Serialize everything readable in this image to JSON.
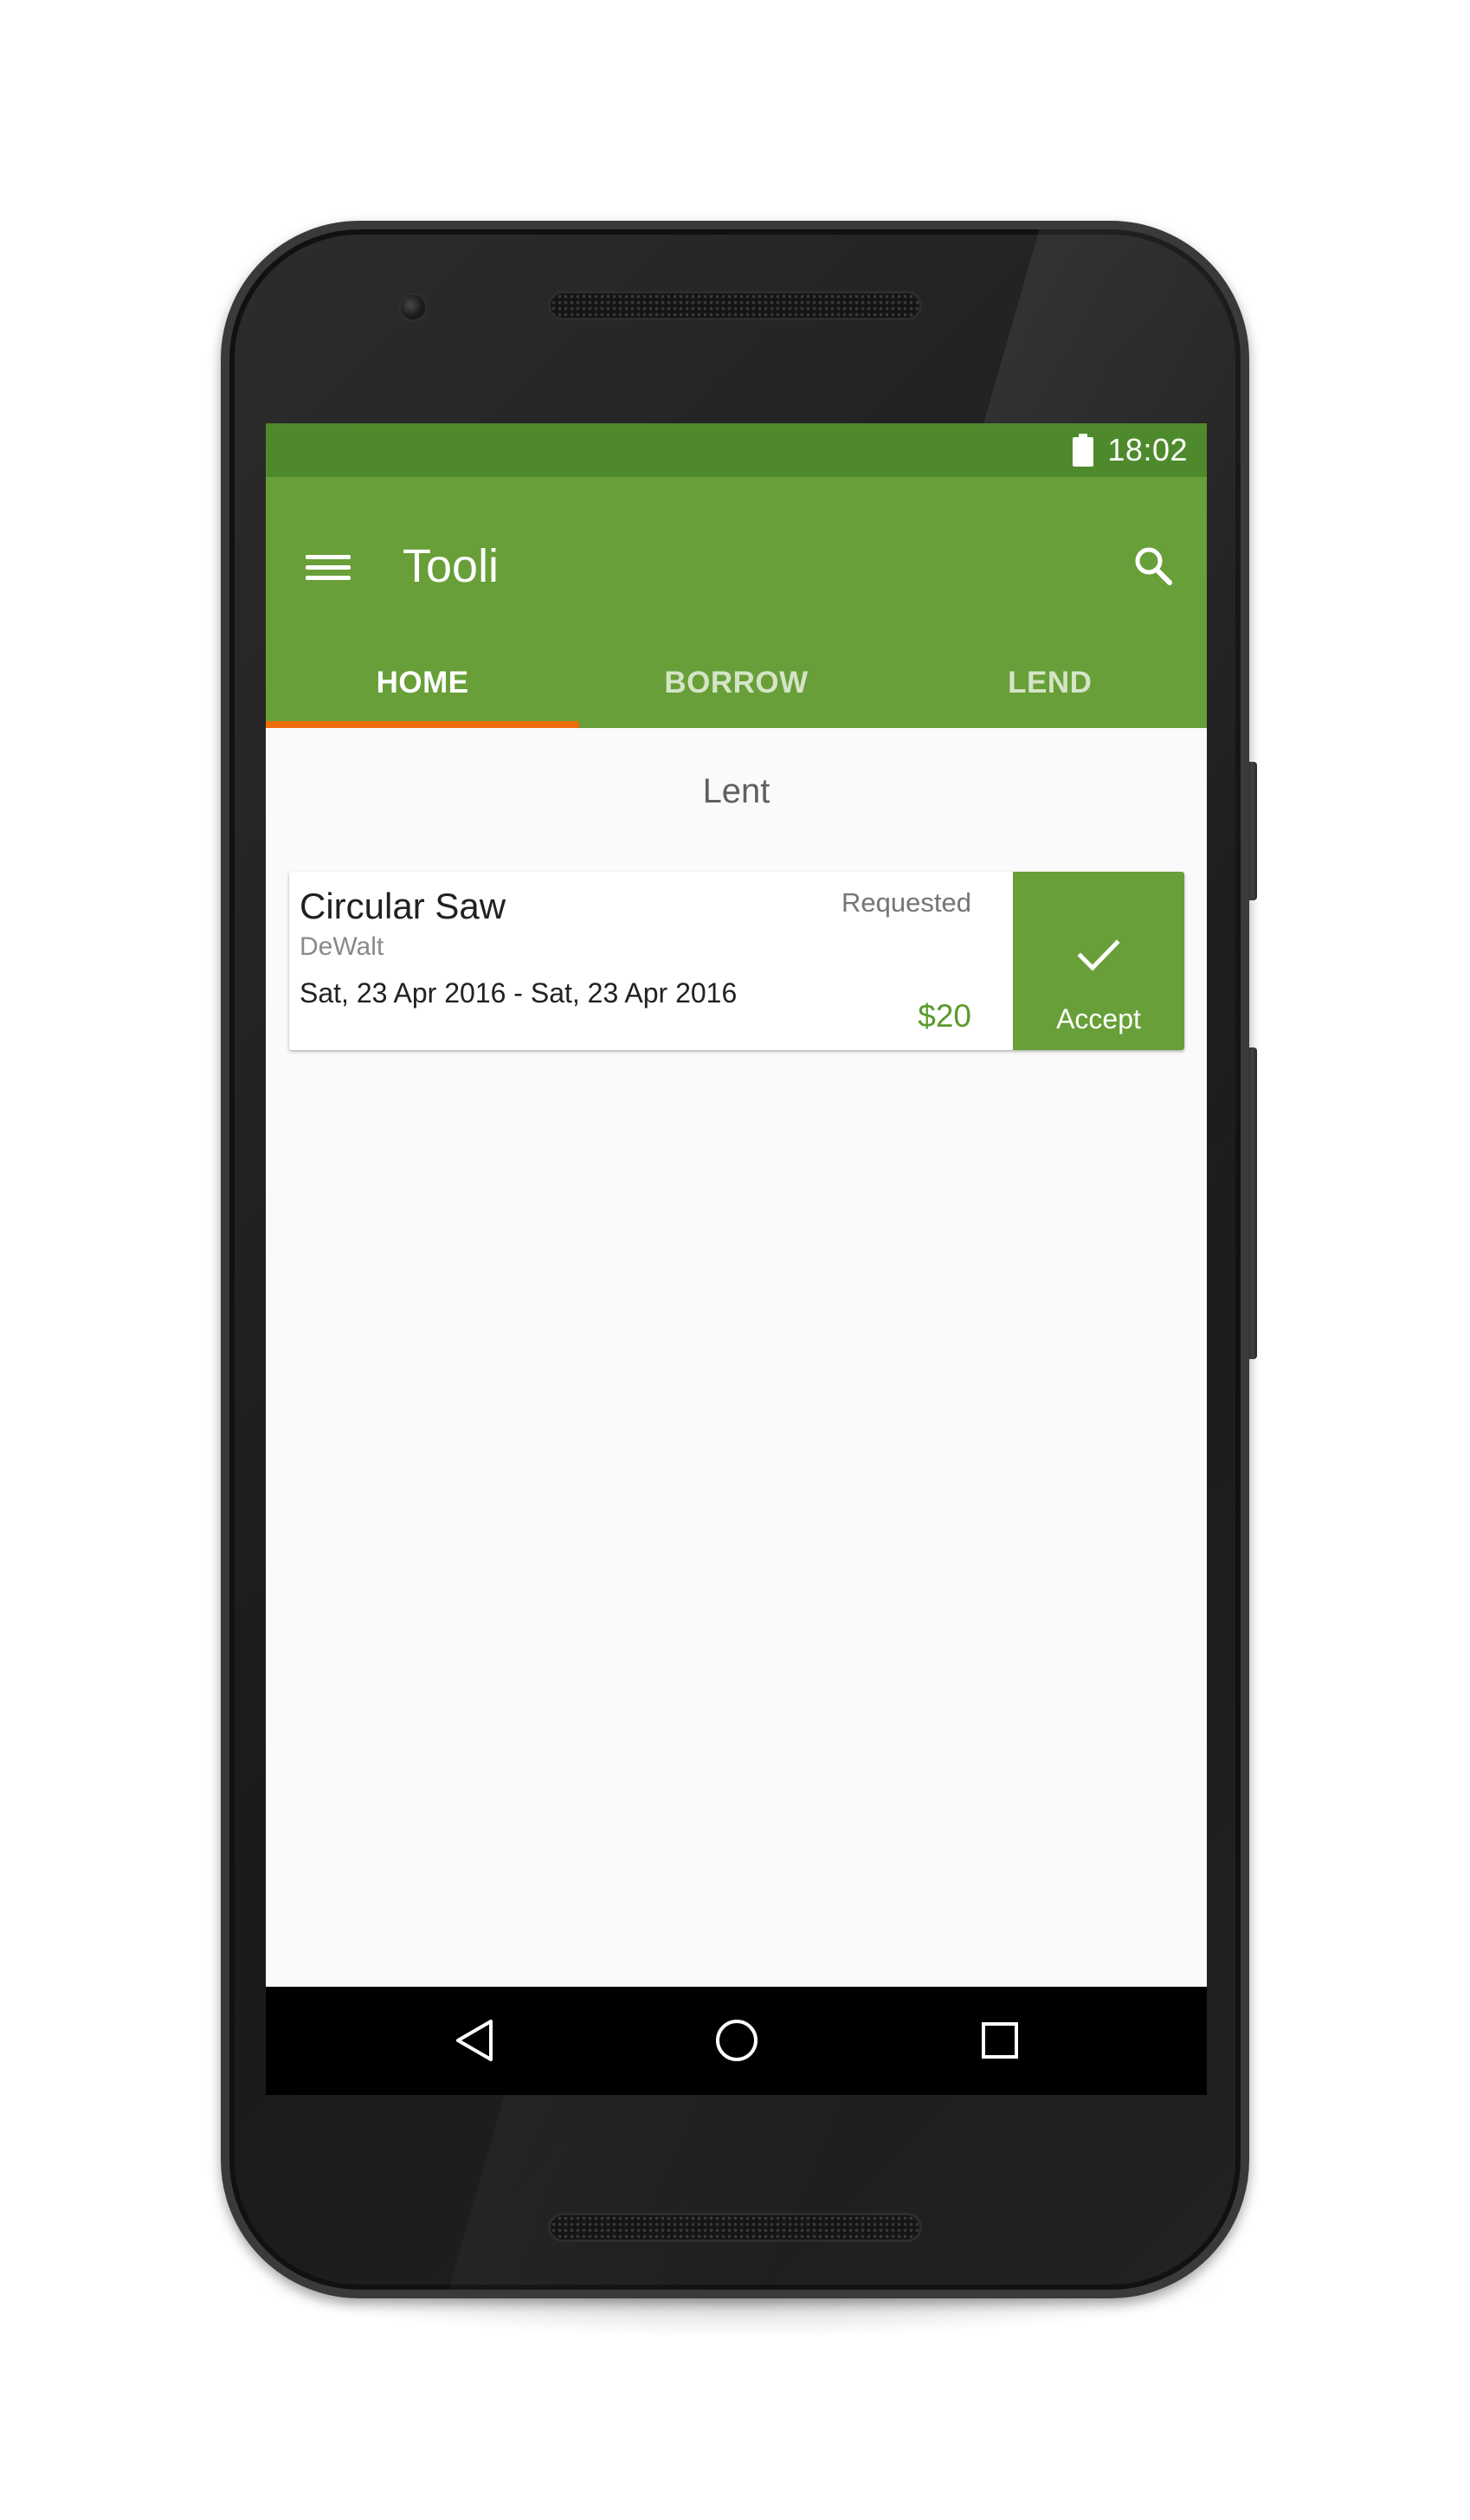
{
  "status_bar": {
    "time": "18:02",
    "battery_icon": "battery-full-icon"
  },
  "app_bar": {
    "title": "Tooli",
    "menu_icon": "hamburger-menu-icon",
    "search_icon": "search-icon",
    "tabs": [
      {
        "label": "HOME",
        "active": true
      },
      {
        "label": "BORROW",
        "active": false
      },
      {
        "label": "LEND",
        "active": false
      }
    ]
  },
  "main": {
    "section_title": "Lent",
    "items": [
      {
        "title": "Circular Saw",
        "brand": "DeWalt",
        "dates": "Sat, 23 Apr 2016 - Sat, 23 Apr 2016",
        "status": "Requested",
        "price": "$20",
        "action": {
          "label": "Accept",
          "icon": "checkmark-icon"
        }
      }
    ]
  },
  "nav_bar": {
    "buttons": [
      "back-icon",
      "home-icon",
      "recents-icon"
    ]
  },
  "colors": {
    "primary": "#689f38",
    "primary_dark": "#4e8a2c",
    "accent": "#ef6c0c",
    "price": "#5a9a2c",
    "background": "#fafafa"
  }
}
